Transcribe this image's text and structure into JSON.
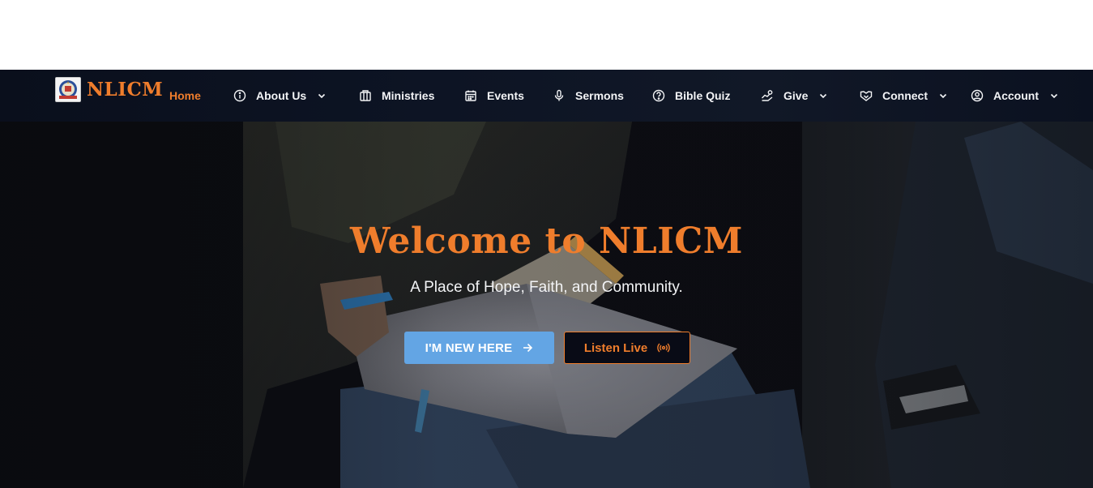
{
  "brand": {
    "name": "NLICM"
  },
  "nav": {
    "home": "Home",
    "about": "About Us",
    "ministries": "Ministries",
    "events": "Events",
    "sermons": "Sermons",
    "quiz": "Bible Quiz",
    "give": "Give",
    "connect": "Connect",
    "account": "Account"
  },
  "icons": {
    "about": "info-icon",
    "ministries": "building-icon",
    "events": "calendar-icon",
    "sermons": "microphone-icon",
    "quiz": "question-icon",
    "give": "hand-coins-icon",
    "connect": "handshake-icon",
    "account": "user-circle-icon"
  },
  "hero": {
    "title": "Welcome to NLICM",
    "subtitle": "A Place of Hope, Faith, and Community.",
    "primary_button": "I'M NEW HERE",
    "secondary_button": "Listen Live"
  },
  "colors": {
    "accent": "#ef7d2c",
    "primary_button": "#63a5e4",
    "navbar": "#0d1424"
  }
}
